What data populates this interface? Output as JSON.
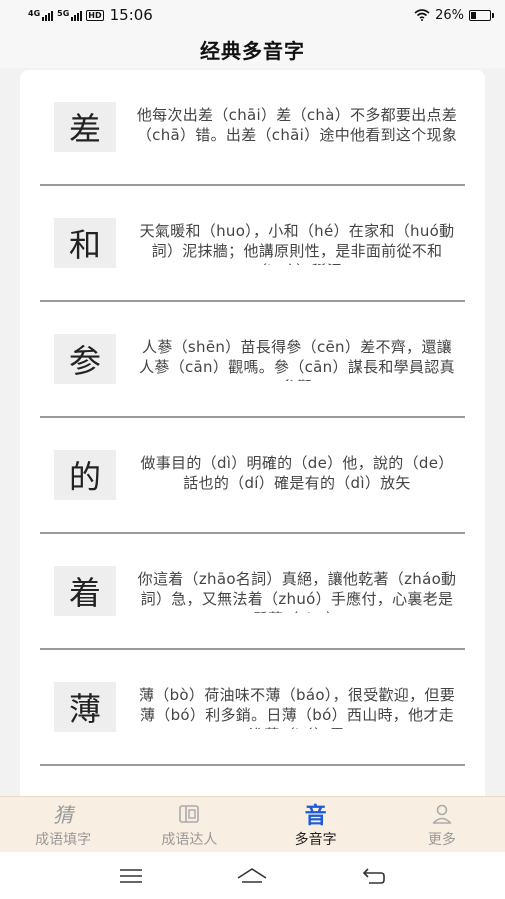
{
  "status_bar": {
    "network1": "4G",
    "network2": "5G",
    "hd": "HD",
    "time": "15:06",
    "battery_text": "26%",
    "battery_level": 0.26
  },
  "header": {
    "title": "经典多音字"
  },
  "items": [
    {
      "char": "差",
      "text": "他每次出差（chāi）差（chà）不多都要出点差（chā）错。出差（chāi）途中他看到这个现象"
    },
    {
      "char": "和",
      "text": "天氣暖和（huo），小和（hé）在家和（huó動詞）泥抹牆；他講原則性，是非面前從不和（huò）稀泥"
    },
    {
      "char": "参",
      "text": "人蔘（shēn）苗長得參（cēn）差不齊，還讓人蔘（cān）觀嗎。參（cān）謀長和學員認真參觀"
    },
    {
      "char": "的",
      "text": "做事目的（dì）明確的（de）他，說的（de）話也的（dí）確是有的（dì）放矢"
    },
    {
      "char": "着",
      "text": "你這着（zhāo名詞）真絕，讓他乾著（zháo動詞）急，又無法着（zhuó）手應付，心裏老是懸著（zhe）"
    },
    {
      "char": "薄",
      "text": "薄（bò）荷油味不薄（báo），很受歡迎，但要薄（bó）利多銷。日薄（bó）西山時，他才走進薄（bó）霧"
    },
    {
      "char": "",
      "text": ""
    }
  ],
  "tabs": [
    {
      "label": "成语填字",
      "icon": "brush-character-icon",
      "glyph": "猜",
      "active": false
    },
    {
      "label": "成语达人",
      "icon": "book-icon",
      "glyph": "",
      "active": false
    },
    {
      "label": "多音字",
      "icon": "sound-character-icon",
      "glyph": "音",
      "active": true
    },
    {
      "label": "更多",
      "icon": "person-icon",
      "glyph": "",
      "active": false
    }
  ],
  "nav": {
    "menu_icon": "menu-icon",
    "home_icon": "home-icon",
    "back_icon": "back-icon"
  },
  "colors": {
    "accent": "#1e5bd8",
    "tabbar_bg": "#f8efe2",
    "divider": "#9a9a9a"
  }
}
